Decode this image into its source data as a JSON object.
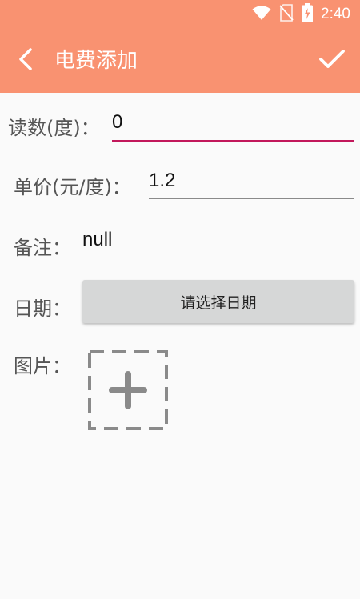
{
  "status_bar": {
    "time": "2:40",
    "icons": [
      "wifi-icon",
      "no-sim-icon",
      "battery-charging-icon"
    ]
  },
  "app_bar": {
    "title": "电费添加",
    "back_icon": "back-arrow-icon",
    "confirm_icon": "check-icon",
    "background_color": "#f99271"
  },
  "form": {
    "reading": {
      "label": "读数(度)：",
      "value": "0"
    },
    "unit_price": {
      "label": "单价(元/度)：",
      "value": "1.2"
    },
    "note": {
      "label": "备注：",
      "value": "null"
    },
    "date": {
      "label": "日期：",
      "button_label": "请选择日期"
    },
    "image": {
      "label": "图片：",
      "add_icon": "add-photo-icon"
    }
  },
  "colors": {
    "accent": "#c2185b",
    "primary": "#f99271"
  }
}
